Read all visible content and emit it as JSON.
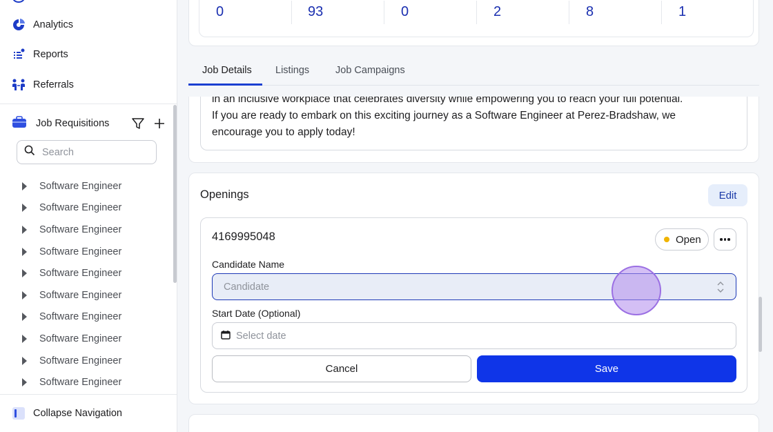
{
  "sidebar": {
    "nav": [
      {
        "label": "Analytics",
        "icon": "analytics-icon"
      },
      {
        "label": "Reports",
        "icon": "reports-icon"
      },
      {
        "label": "Referrals",
        "icon": "referrals-icon"
      }
    ],
    "requisitions_title": "Job Requisitions",
    "search_placeholder": "Search",
    "requisitions": [
      "Software Engineer",
      "Software Engineer",
      "Software Engineer",
      "Software Engineer",
      "Software Engineer",
      "Software Engineer",
      "Software Engineer",
      "Software Engineer",
      "Software Engineer",
      "Software Engineer"
    ],
    "collapse_label": "Collapse Navigation"
  },
  "stats": [
    "0",
    "93",
    "0",
    "2",
    "8",
    "1"
  ],
  "tabs": [
    "Job Details",
    "Listings",
    "Job Campaigns"
  ],
  "description": {
    "lines": [
      "in an inclusive workplace that celebrates diversity while empowering you to reach your full potential.",
      "If you are ready to embark on this exciting journey as a Software Engineer at Perez-Bradshaw, we",
      "encourage you to apply today!"
    ]
  },
  "openings": {
    "title": "Openings",
    "edit_label": "Edit",
    "opening_id": "4169995048",
    "status": "Open",
    "status_color": "#f0b400",
    "candidate_label": "Candidate Name",
    "candidate_placeholder": "Candidate",
    "start_date_label": "Start Date (Optional)",
    "start_date_placeholder": "Select date",
    "cancel_label": "Cancel",
    "save_label": "Save"
  },
  "colors": {
    "accent": "#0f35e8",
    "stat_number": "#1a2fb0"
  }
}
